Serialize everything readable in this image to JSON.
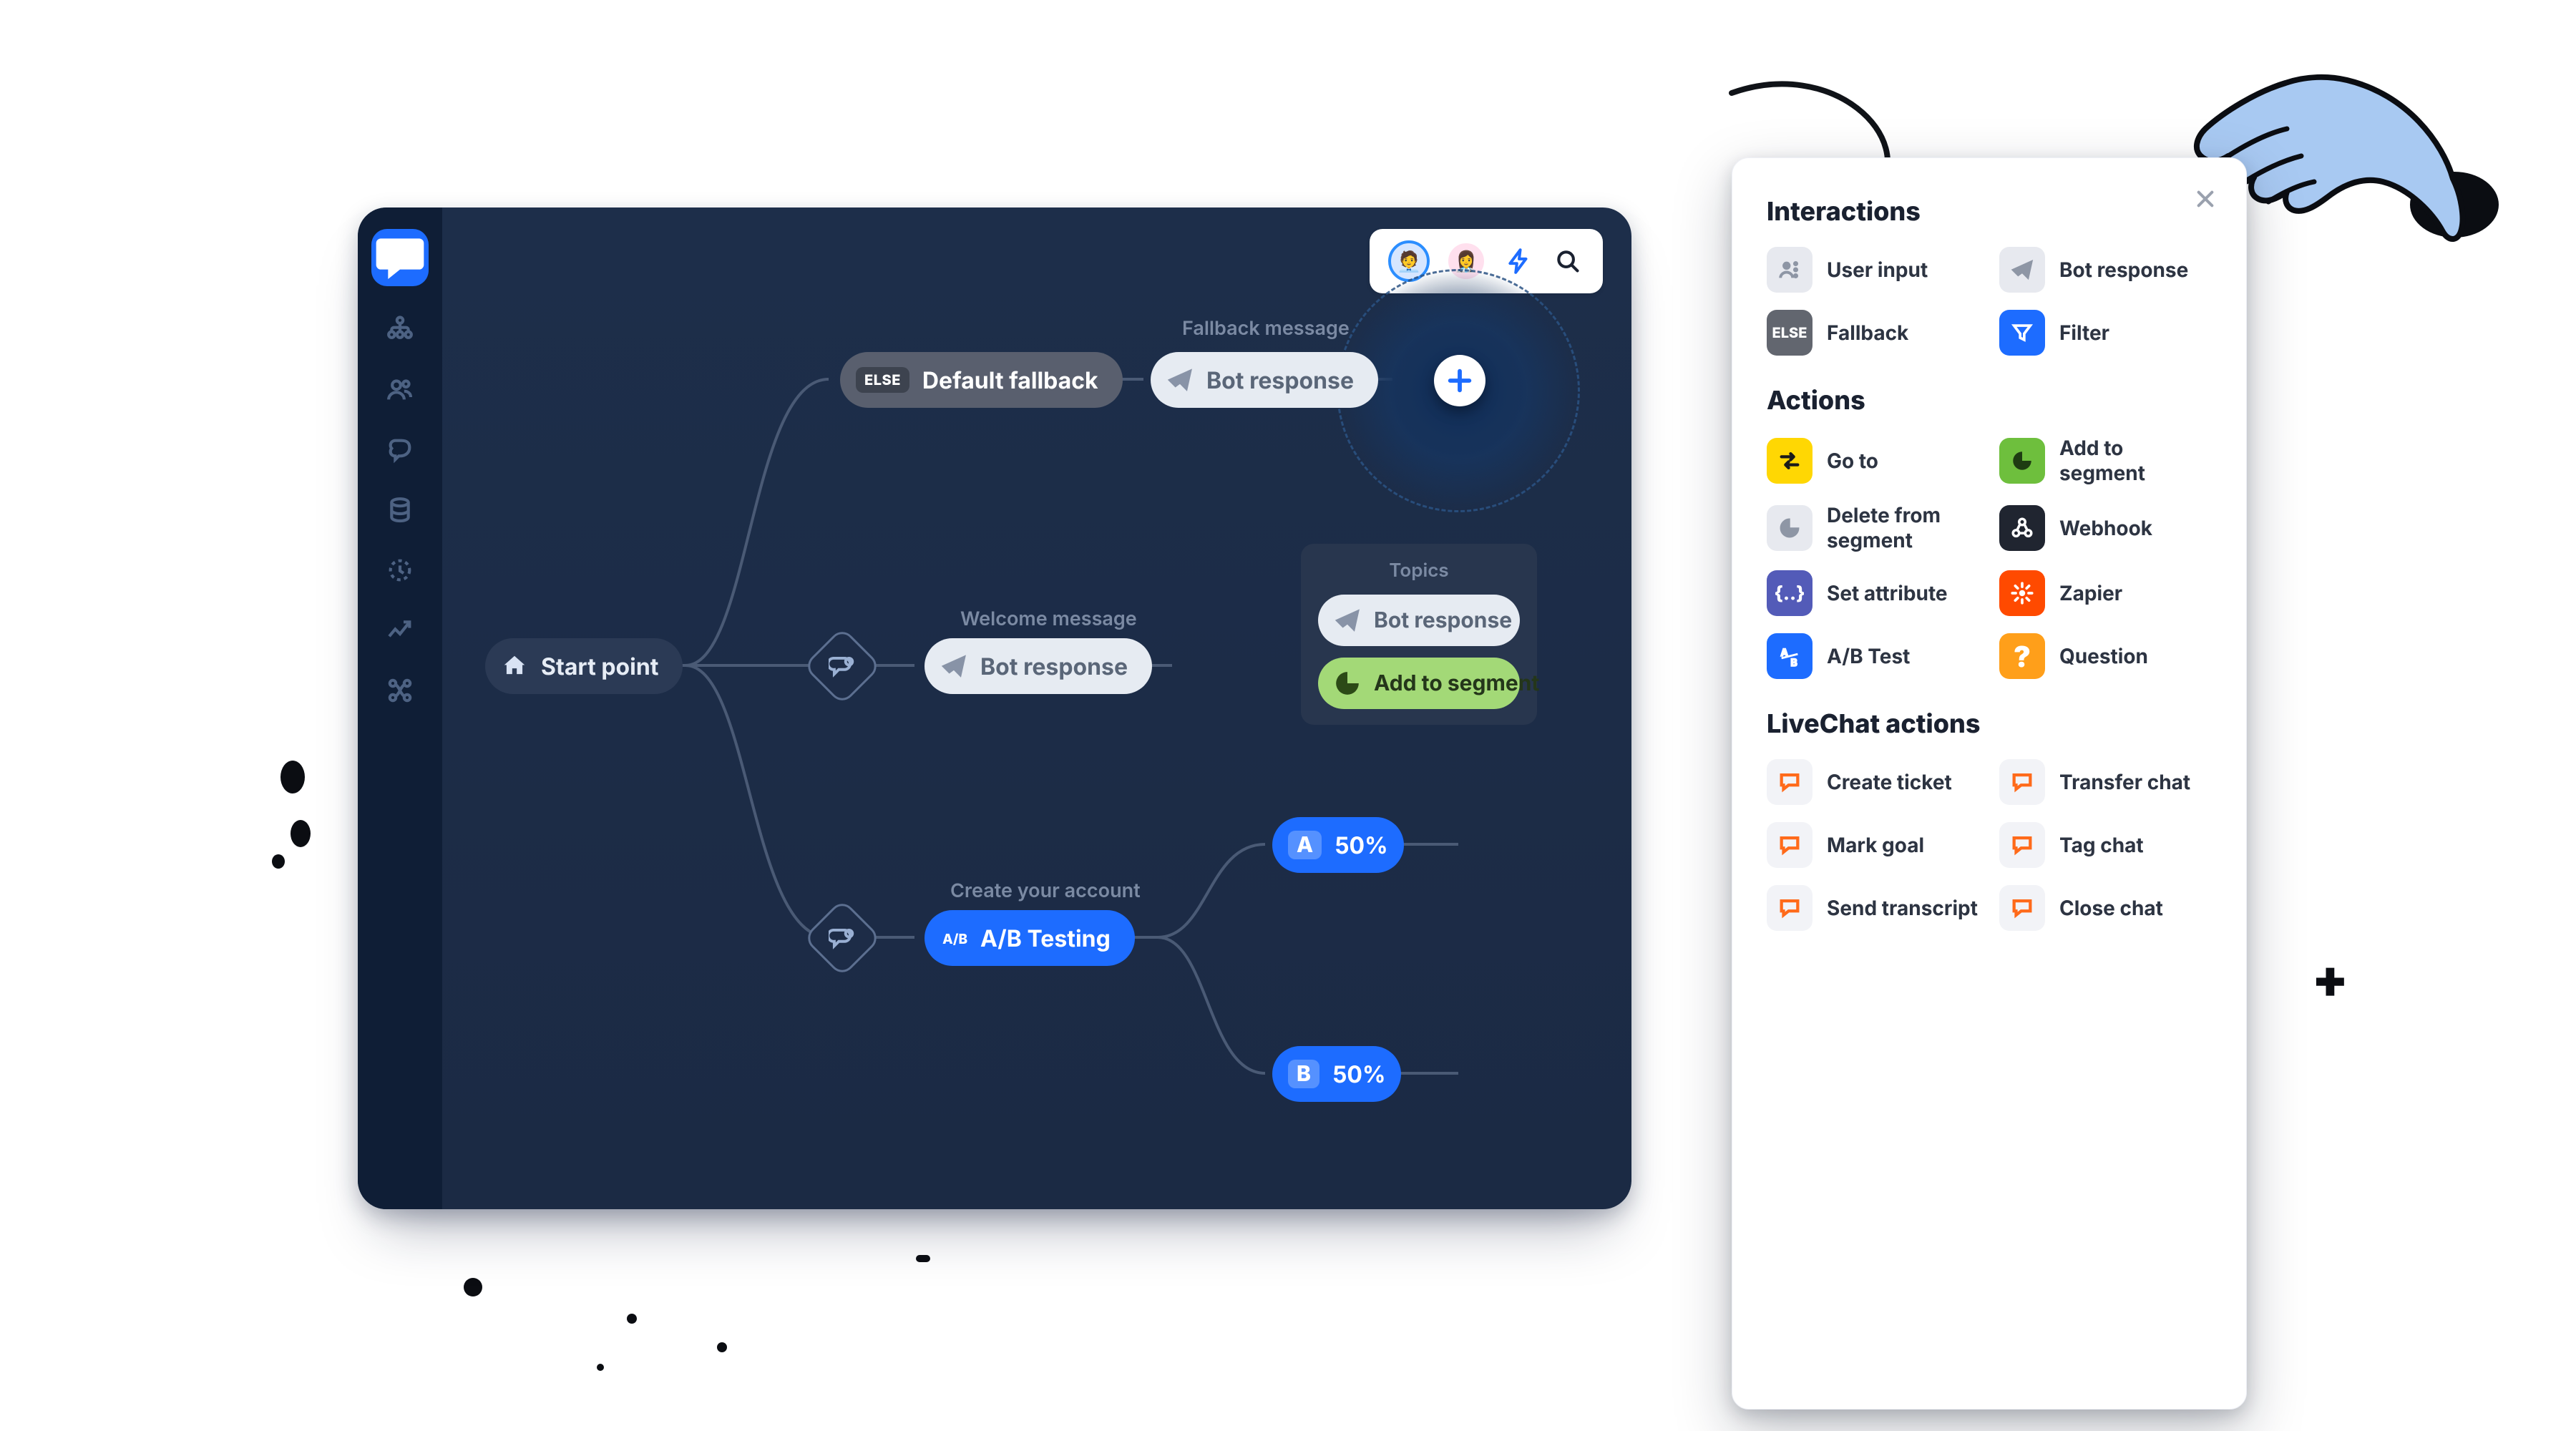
{
  "toolbar": {
    "bolt": "Quick actions",
    "search": "Search"
  },
  "sidebar_icons": [
    "tree",
    "users",
    "brain",
    "database",
    "clock",
    "trend",
    "routes"
  ],
  "flow": {
    "start": "Start point",
    "fallback": {
      "badge": "ELSE",
      "label": "Default fallback",
      "hint": "Fallback message",
      "response": "Bot response"
    },
    "welcome": {
      "hint": "Welcome message",
      "response": "Bot response"
    },
    "topics_card": {
      "title": "Topics",
      "rows": [
        "Bot response",
        "Add to segment"
      ]
    },
    "ab": {
      "hint": "Create your account",
      "label": "A/B Testing",
      "a": "50%",
      "b": "50%"
    }
  },
  "panel": {
    "close": "Close",
    "sections": {
      "interactions": {
        "title": "Interactions",
        "items": [
          "User input",
          "Bot response",
          "Fallback",
          "Filter"
        ]
      },
      "actions": {
        "title": "Actions",
        "items": [
          "Go to",
          "Add to segment",
          "Delete from segment",
          "Webhook",
          "Set attribute",
          "Zapier",
          "A/B Test",
          "Question"
        ]
      },
      "livechat": {
        "title": "LiveChat actions",
        "items": [
          "Create ticket",
          "Transfer chat",
          "Mark goal",
          "Tag chat",
          "Send transcript",
          "Close chat"
        ]
      }
    }
  }
}
